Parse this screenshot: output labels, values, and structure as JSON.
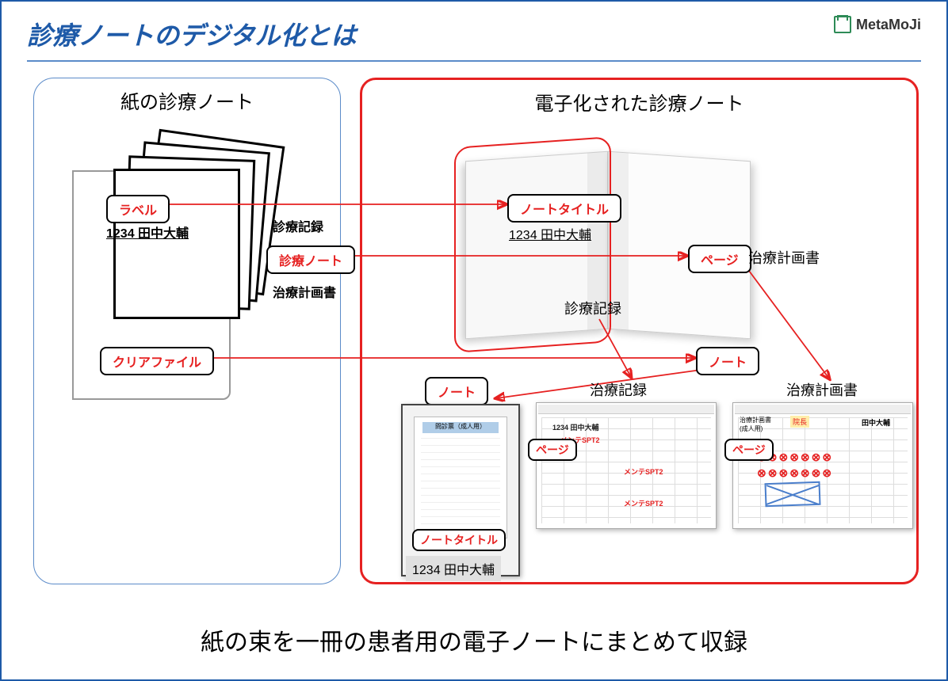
{
  "header": {
    "title": "診療ノートのデジタル化とは",
    "brand": "MetaMoJi"
  },
  "left": {
    "heading": "紙の診療ノート",
    "label_label": "ラベル",
    "patient_id": "1234 田中大輔",
    "note_label": "診療ノート",
    "folder_label": "クリアファイル",
    "doc1": "診療記録",
    "doc2": "治療計画書"
  },
  "right": {
    "heading": "電子化された診療ノート",
    "note_title_label": "ノートタイトル",
    "patient_id": "1234 田中大輔",
    "page_label": "ページ",
    "page_caption_plan": "治療計画書",
    "page_caption_record": "診療記録",
    "note_label": "ノート",
    "thumb1_title": "ノート",
    "thumb1_subtitle": "ノートタイトル",
    "thumb1_patient": "1234 田中大輔",
    "thumb2_title": "治療記録",
    "thumb2_page": "ページ",
    "thumb3_title": "治療計画書",
    "thumb3_page": "ページ"
  },
  "footer": "紙の束を一冊の患者用の電子ノートにまとめて収録"
}
